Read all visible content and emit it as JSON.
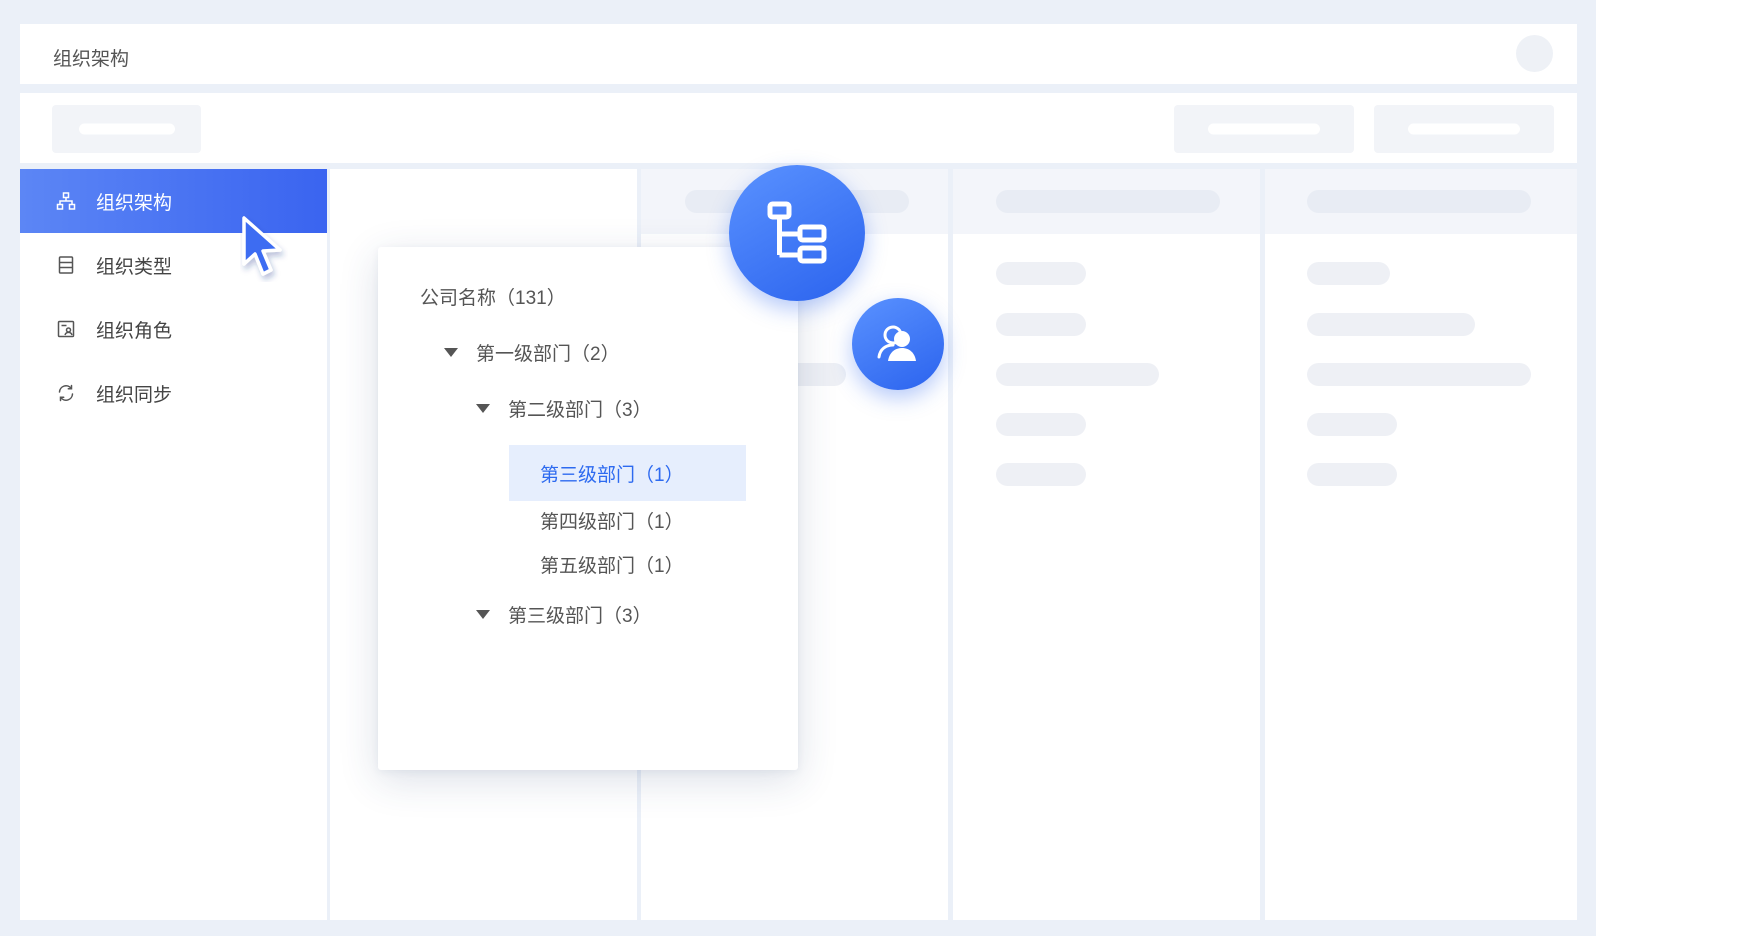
{
  "header": {
    "title": "组织架构"
  },
  "sidebar": {
    "items": [
      {
        "label": "组织架构",
        "icon": "org-chart-icon",
        "active": true
      },
      {
        "label": "组织类型",
        "icon": "list-doc-icon",
        "active": false
      },
      {
        "label": "组织角色",
        "icon": "role-card-icon",
        "active": false
      },
      {
        "label": "组织同步",
        "icon": "sync-icon",
        "active": false
      }
    ]
  },
  "tree": {
    "root": "公司名称（131）",
    "nodes": [
      {
        "label": "第一级部门（2）",
        "expanded": true
      },
      {
        "label": "第二级部门（3）",
        "expanded": true
      },
      {
        "label": "第三级部门（1）",
        "selected": true
      },
      {
        "label": "第四级部门（1）"
      },
      {
        "label": "第五级部门（1）"
      },
      {
        "label": "第三级部门（3）",
        "expanded": true
      }
    ]
  },
  "badges": {
    "structure": "org-structure-icon",
    "users": "user-group-icon"
  },
  "colors": {
    "accent": "#3a64f0",
    "selected_bg": "#e6eefd",
    "frame_bg": "#ebf0f8"
  }
}
